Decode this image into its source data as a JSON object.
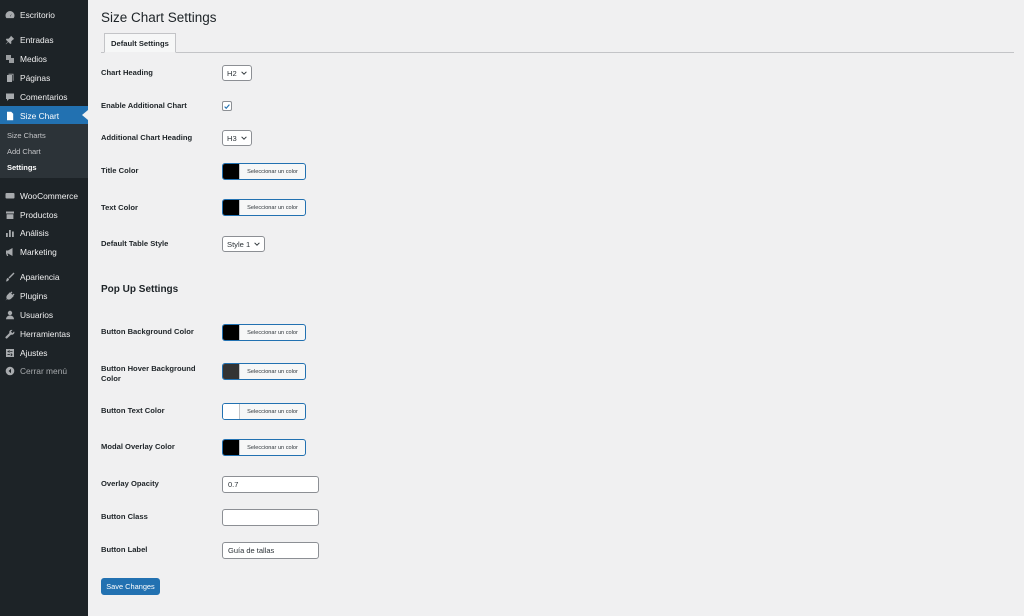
{
  "sidebar": {
    "items": [
      {
        "label": "Escritorio",
        "icon": "dashboard-icon"
      },
      {
        "label": "Entradas",
        "icon": "pin-icon"
      },
      {
        "label": "Medios",
        "icon": "media-icon"
      },
      {
        "label": "Páginas",
        "icon": "page-icon"
      },
      {
        "label": "Comentarios",
        "icon": "comment-icon"
      },
      {
        "label": "Size Chart",
        "icon": "document-icon"
      },
      {
        "label": "WooCommerce",
        "icon": "woo-icon"
      },
      {
        "label": "Productos",
        "icon": "archive-icon"
      },
      {
        "label": "Análisis",
        "icon": "bar-chart-icon"
      },
      {
        "label": "Marketing",
        "icon": "megaphone-icon"
      },
      {
        "label": "Apariencia",
        "icon": "brush-icon"
      },
      {
        "label": "Plugins",
        "icon": "plug-icon"
      },
      {
        "label": "Usuarios",
        "icon": "user-icon"
      },
      {
        "label": "Herramientas",
        "icon": "wrench-icon"
      },
      {
        "label": "Ajustes",
        "icon": "settings-icon"
      }
    ],
    "submenu": [
      "Size Charts",
      "Add Chart",
      "Settings"
    ],
    "collapse_label": "Cerrar menú"
  },
  "page": {
    "title": "Size Chart Settings",
    "tab": "Default Settings",
    "fields": {
      "chart_heading": {
        "label": "Chart Heading",
        "value": "H2"
      },
      "enable_additional": {
        "label": "Enable Additional Chart",
        "checked": true
      },
      "additional_heading": {
        "label": "Additional Chart Heading",
        "value": "H3"
      },
      "title_color": {
        "label": "Title Color",
        "color": "#000000"
      },
      "text_color": {
        "label": "Text Color",
        "color": "#000000"
      },
      "table_style": {
        "label": "Default Table Style",
        "value": "Style 1"
      }
    },
    "popup_title": "Pop Up Settings",
    "popup": {
      "button_bg": {
        "label": "Button Background Color",
        "color": "#000000"
      },
      "button_hover_bg": {
        "label": "Button Hover Background Color",
        "color": "#333333"
      },
      "button_text": {
        "label": "Button Text Color",
        "color": "#ffffff"
      },
      "overlay_color": {
        "label": "Modal Overlay Color",
        "color": "#000000"
      },
      "overlay_opacity": {
        "label": "Overlay Opacity",
        "value": "0.7"
      },
      "button_class": {
        "label": "Button Class",
        "value": ""
      },
      "button_label": {
        "label": "Button Label",
        "value": "Guía de tallas"
      }
    },
    "color_button_text": "Seleccionar un color",
    "save_label": "Save Changes"
  },
  "colors": {
    "accent": "#2271b1",
    "sidebar_bg": "#1d2327",
    "page_bg": "#f0f0f1"
  }
}
